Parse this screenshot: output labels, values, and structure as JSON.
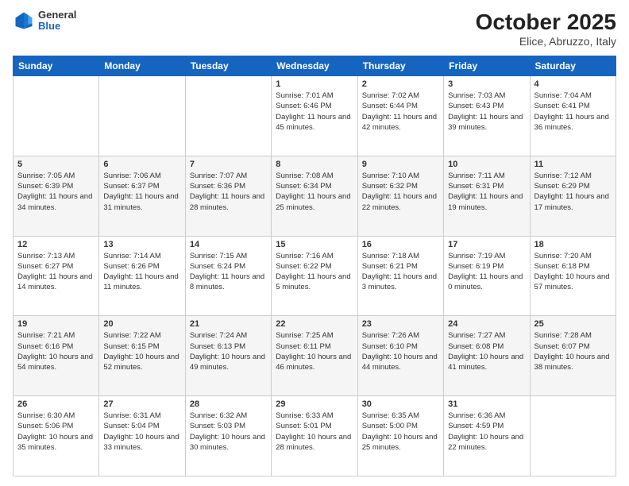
{
  "header": {
    "logo_general": "General",
    "logo_blue": "Blue",
    "month_year": "October 2025",
    "location": "Elice, Abruzzo, Italy"
  },
  "days_of_week": [
    "Sunday",
    "Monday",
    "Tuesday",
    "Wednesday",
    "Thursday",
    "Friday",
    "Saturday"
  ],
  "weeks": [
    [
      {
        "day": "",
        "sunrise": "",
        "sunset": "",
        "daylight": ""
      },
      {
        "day": "",
        "sunrise": "",
        "sunset": "",
        "daylight": ""
      },
      {
        "day": "",
        "sunrise": "",
        "sunset": "",
        "daylight": ""
      },
      {
        "day": "1",
        "sunrise": "7:01 AM",
        "sunset": "6:46 PM",
        "daylight": "11 hours and 45 minutes."
      },
      {
        "day": "2",
        "sunrise": "7:02 AM",
        "sunset": "6:44 PM",
        "daylight": "11 hours and 42 minutes."
      },
      {
        "day": "3",
        "sunrise": "7:03 AM",
        "sunset": "6:43 PM",
        "daylight": "11 hours and 39 minutes."
      },
      {
        "day": "4",
        "sunrise": "7:04 AM",
        "sunset": "6:41 PM",
        "daylight": "11 hours and 36 minutes."
      }
    ],
    [
      {
        "day": "5",
        "sunrise": "7:05 AM",
        "sunset": "6:39 PM",
        "daylight": "11 hours and 34 minutes."
      },
      {
        "day": "6",
        "sunrise": "7:06 AM",
        "sunset": "6:37 PM",
        "daylight": "11 hours and 31 minutes."
      },
      {
        "day": "7",
        "sunrise": "7:07 AM",
        "sunset": "6:36 PM",
        "daylight": "11 hours and 28 minutes."
      },
      {
        "day": "8",
        "sunrise": "7:08 AM",
        "sunset": "6:34 PM",
        "daylight": "11 hours and 25 minutes."
      },
      {
        "day": "9",
        "sunrise": "7:10 AM",
        "sunset": "6:32 PM",
        "daylight": "11 hours and 22 minutes."
      },
      {
        "day": "10",
        "sunrise": "7:11 AM",
        "sunset": "6:31 PM",
        "daylight": "11 hours and 19 minutes."
      },
      {
        "day": "11",
        "sunrise": "7:12 AM",
        "sunset": "6:29 PM",
        "daylight": "11 hours and 17 minutes."
      }
    ],
    [
      {
        "day": "12",
        "sunrise": "7:13 AM",
        "sunset": "6:27 PM",
        "daylight": "11 hours and 14 minutes."
      },
      {
        "day": "13",
        "sunrise": "7:14 AM",
        "sunset": "6:26 PM",
        "daylight": "11 hours and 11 minutes."
      },
      {
        "day": "14",
        "sunrise": "7:15 AM",
        "sunset": "6:24 PM",
        "daylight": "11 hours and 8 minutes."
      },
      {
        "day": "15",
        "sunrise": "7:16 AM",
        "sunset": "6:22 PM",
        "daylight": "11 hours and 5 minutes."
      },
      {
        "day": "16",
        "sunrise": "7:18 AM",
        "sunset": "6:21 PM",
        "daylight": "11 hours and 3 minutes."
      },
      {
        "day": "17",
        "sunrise": "7:19 AM",
        "sunset": "6:19 PM",
        "daylight": "11 hours and 0 minutes."
      },
      {
        "day": "18",
        "sunrise": "7:20 AM",
        "sunset": "6:18 PM",
        "daylight": "10 hours and 57 minutes."
      }
    ],
    [
      {
        "day": "19",
        "sunrise": "7:21 AM",
        "sunset": "6:16 PM",
        "daylight": "10 hours and 54 minutes."
      },
      {
        "day": "20",
        "sunrise": "7:22 AM",
        "sunset": "6:15 PM",
        "daylight": "10 hours and 52 minutes."
      },
      {
        "day": "21",
        "sunrise": "7:24 AM",
        "sunset": "6:13 PM",
        "daylight": "10 hours and 49 minutes."
      },
      {
        "day": "22",
        "sunrise": "7:25 AM",
        "sunset": "6:11 PM",
        "daylight": "10 hours and 46 minutes."
      },
      {
        "day": "23",
        "sunrise": "7:26 AM",
        "sunset": "6:10 PM",
        "daylight": "10 hours and 44 minutes."
      },
      {
        "day": "24",
        "sunrise": "7:27 AM",
        "sunset": "6:08 PM",
        "daylight": "10 hours and 41 minutes."
      },
      {
        "day": "25",
        "sunrise": "7:28 AM",
        "sunset": "6:07 PM",
        "daylight": "10 hours and 38 minutes."
      }
    ],
    [
      {
        "day": "26",
        "sunrise": "6:30 AM",
        "sunset": "5:06 PM",
        "daylight": "10 hours and 35 minutes."
      },
      {
        "day": "27",
        "sunrise": "6:31 AM",
        "sunset": "5:04 PM",
        "daylight": "10 hours and 33 minutes."
      },
      {
        "day": "28",
        "sunrise": "6:32 AM",
        "sunset": "5:03 PM",
        "daylight": "10 hours and 30 minutes."
      },
      {
        "day": "29",
        "sunrise": "6:33 AM",
        "sunset": "5:01 PM",
        "daylight": "10 hours and 28 minutes."
      },
      {
        "day": "30",
        "sunrise": "6:35 AM",
        "sunset": "5:00 PM",
        "daylight": "10 hours and 25 minutes."
      },
      {
        "day": "31",
        "sunrise": "6:36 AM",
        "sunset": "4:59 PM",
        "daylight": "10 hours and 22 minutes."
      },
      {
        "day": "",
        "sunrise": "",
        "sunset": "",
        "daylight": ""
      }
    ]
  ]
}
